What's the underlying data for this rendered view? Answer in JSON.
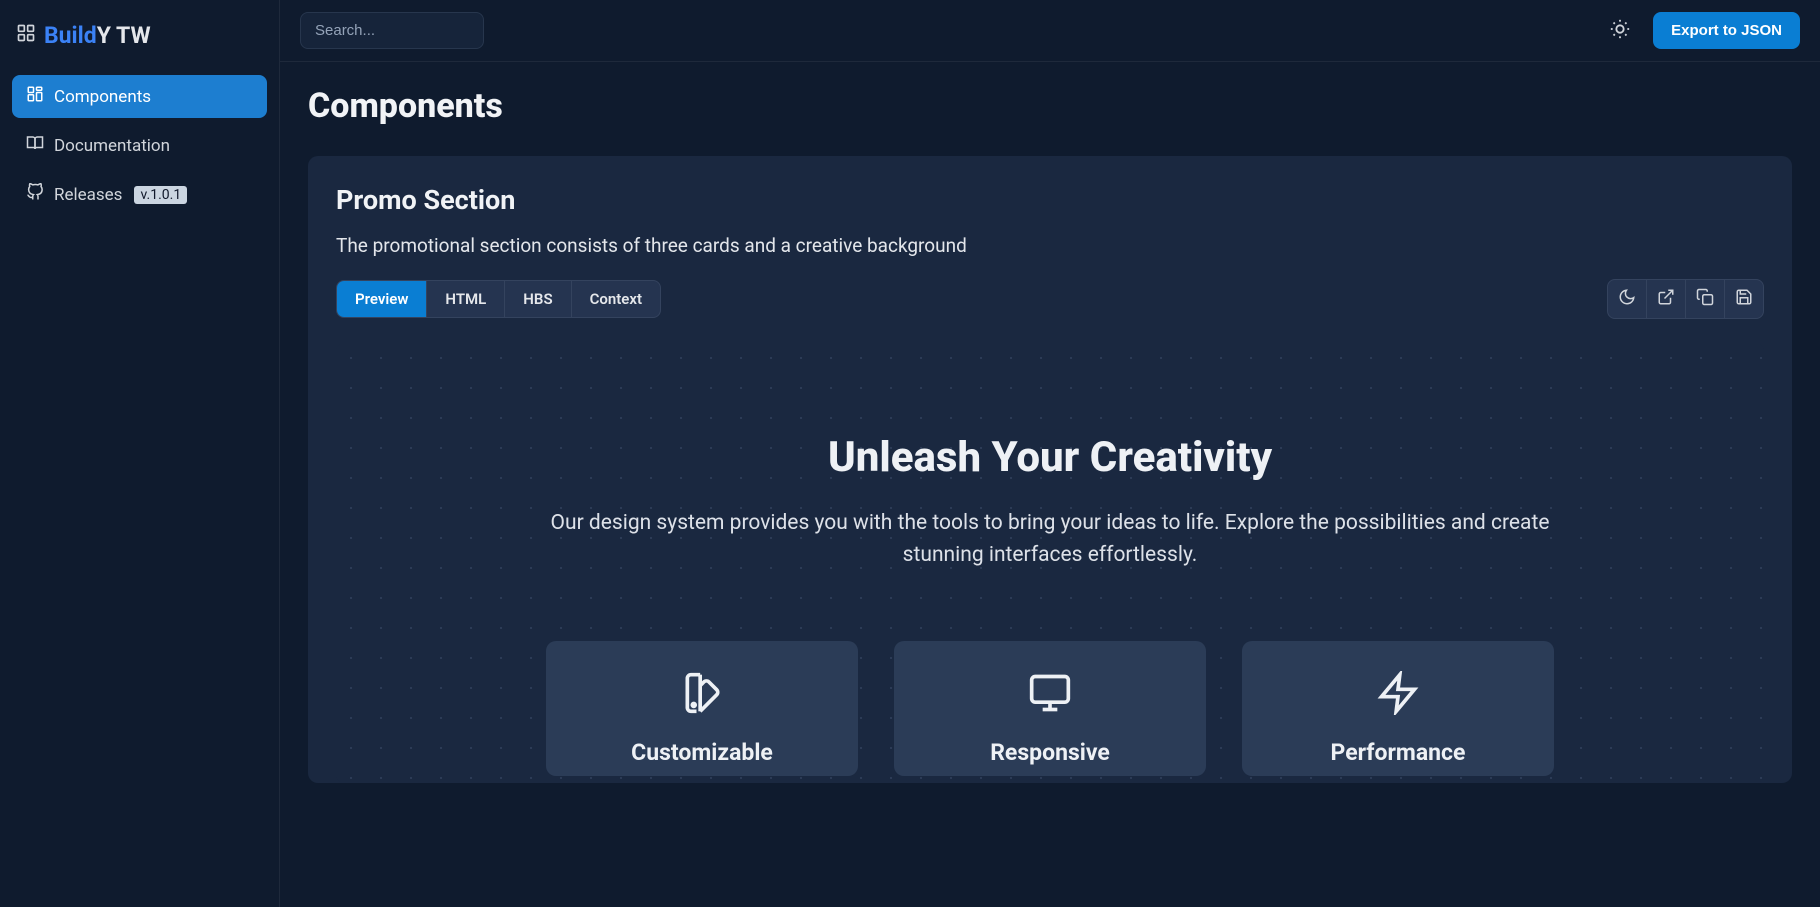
{
  "brand": {
    "part1": "Build",
    "part2": "Y TW"
  },
  "sidebar": {
    "items": [
      {
        "label": "Components",
        "active": true
      },
      {
        "label": "Documentation",
        "active": false
      },
      {
        "label": "Releases",
        "active": false,
        "badge": "v.1.0.1"
      }
    ]
  },
  "topbar": {
    "search_placeholder": "Search...",
    "export_label": "Export to JSON"
  },
  "page": {
    "title": "Components"
  },
  "component": {
    "title": "Promo Section",
    "description": "The promotional section consists of three cards and a creative background",
    "tabs": [
      "Preview",
      "HTML",
      "HBS",
      "Context"
    ],
    "active_tab": "Preview",
    "preview": {
      "hero_title": "Unleash Your Creativity",
      "hero_desc": "Our design system provides you with the tools to bring your ideas to life. Explore the possibilities and create stunning interfaces effortlessly.",
      "cards": [
        {
          "title": "Customizable"
        },
        {
          "title": "Responsive"
        },
        {
          "title": "Performance"
        }
      ]
    }
  }
}
